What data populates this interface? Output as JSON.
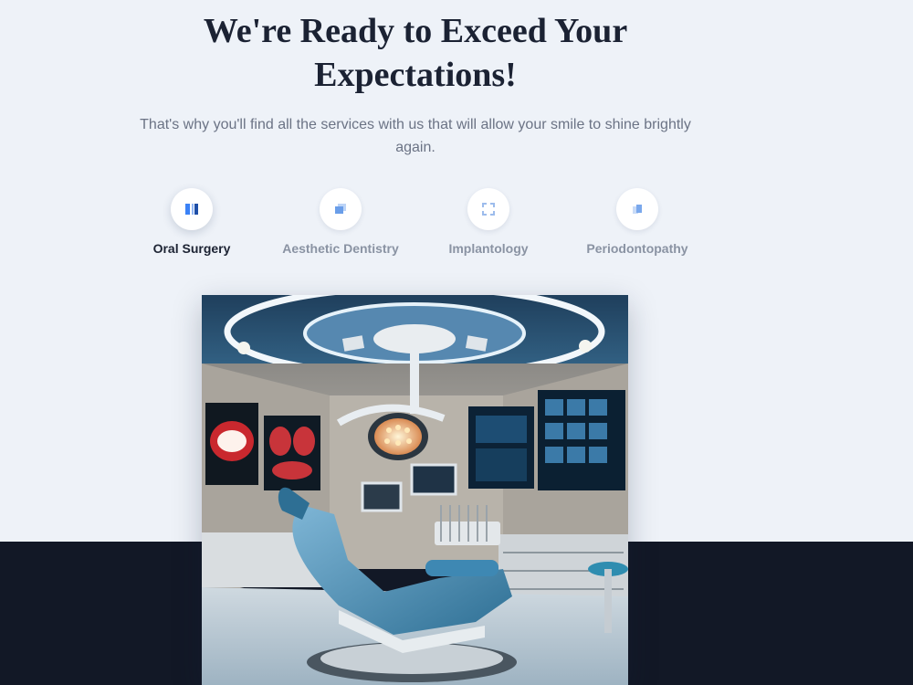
{
  "hero": {
    "title": "We're Ready to Exceed Your Expectations!",
    "subtitle": "That's why you'll find all the services with us that will allow your smile to shine brightly again."
  },
  "tabs": [
    {
      "label": "Oral Surgery",
      "icon": "columns-icon",
      "active": true
    },
    {
      "label": "Aesthetic Dentistry",
      "icon": "layers-icon",
      "active": false
    },
    {
      "label": "Implantology",
      "icon": "expand-icon",
      "active": false
    },
    {
      "label": "Periodontopathy",
      "icon": "square-stack-icon",
      "active": false
    }
  ],
  "colors": {
    "background": "#eef2f8",
    "dark_band": "#121826",
    "accent": "#3b82f6",
    "heading": "#1b2233",
    "muted": "#8a93a3"
  },
  "image": {
    "subject": "dental-clinic-room-icon"
  }
}
